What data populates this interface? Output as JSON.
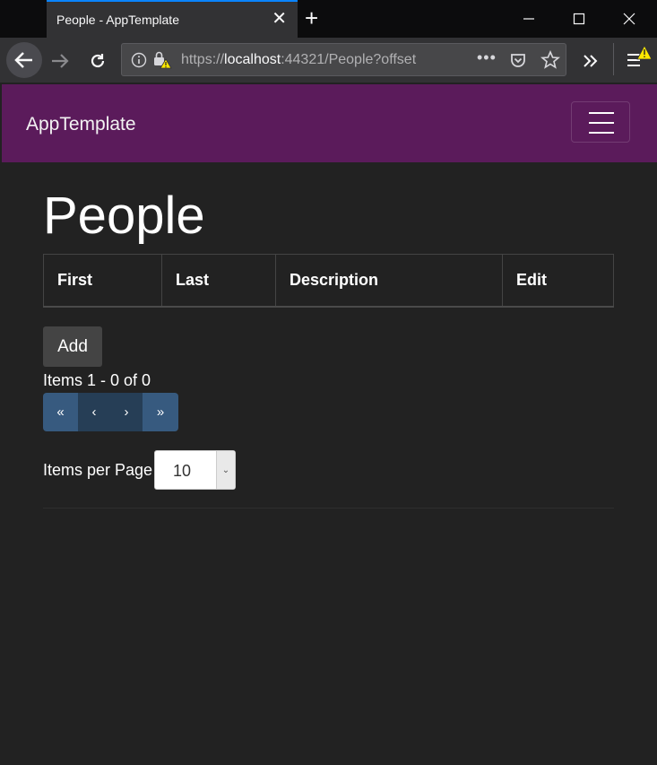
{
  "browser": {
    "tab_title": "People - AppTemplate",
    "url_prefix": "https://",
    "url_host": "localhost",
    "url_rest": ":44321/People?offset"
  },
  "navbar": {
    "brand": "AppTemplate"
  },
  "page": {
    "title": "People",
    "table": {
      "headers": [
        "First",
        "Last",
        "Description",
        "Edit"
      ]
    },
    "add_label": "Add",
    "items_range": "Items 1 - 0 of 0",
    "pager": {
      "first": "«",
      "prev": "‹",
      "next": "›",
      "last": "»"
    },
    "items_per_page_label": "Items per Page",
    "items_per_page_value": "10"
  },
  "colors": {
    "navbar_bg": "#5b1b5b",
    "page_bg": "#222222",
    "pager_active": "#375a7f",
    "tab_accent": "#0a84ff"
  }
}
